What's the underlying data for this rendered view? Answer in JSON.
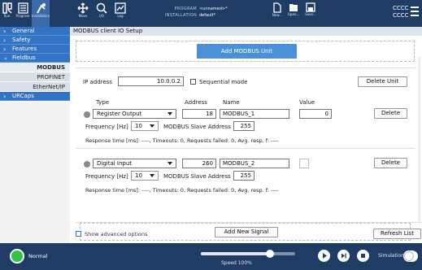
{
  "header": {
    "run": "Run",
    "program": "Program",
    "installation": "Installation",
    "move": "Move",
    "io": "I/O",
    "log": "Log",
    "program_label": "PROGRAM",
    "program_value": "<unnamed>*",
    "installation_label": "INSTALLATION",
    "installation_value": "default*",
    "new": "New...",
    "open": "Open...",
    "save": "Save...",
    "cccc1": "CCCC",
    "cccc2": "CCCC"
  },
  "sidebar": {
    "items": [
      {
        "label": "General"
      },
      {
        "label": "Safety"
      },
      {
        "label": "Features"
      },
      {
        "label": "Fieldbus"
      },
      {
        "label": "URCaps"
      }
    ],
    "sub": [
      {
        "label": "MODBUS"
      },
      {
        "label": "PROFINET"
      },
      {
        "label": "EtherNet/IP"
      }
    ]
  },
  "main": {
    "title": "MODBUS client IO Setup",
    "add_unit": "Add MODBUS Unit",
    "ip_label": "IP address",
    "ip_value": "10.0.0.2",
    "sequential": "Sequential mode",
    "delete_unit": "Delete Unit",
    "col_type": "Type",
    "col_address": "Address",
    "col_name": "Name",
    "col_value": "Value",
    "signals": [
      {
        "type": "Register Output",
        "address": "18",
        "name": "MODBUS_1",
        "value": "0",
        "delete": "Delete",
        "freq_label": "Frequency [Hz]",
        "freq": "10",
        "slave_label": "MODBUS Slave Address",
        "slave": "255",
        "response": "Response time [ms]: ----,   Timeouts:   0,   Requests failed:   0,   Avg. resp. f: ----"
      },
      {
        "type": "Digital Input",
        "address": "260",
        "name": "MODBUS_2",
        "value": "",
        "delete": "Delete",
        "freq_label": "Frequency [Hz]",
        "freq": "10",
        "slave_label": "MODBUS Slave Address",
        "slave": "255",
        "response": "Response time [ms]: ----,   Timeouts:   0,   Requests failed:   0,   Avg. resp. f: ----"
      }
    ],
    "add_signal": "Add New Signal",
    "show_advanced": "Show advanced options",
    "refresh": "Refresh List"
  },
  "footer": {
    "status": "Normal",
    "speed": "Speed 100%",
    "speed_fraction": 0.73,
    "simulation": "Simulation"
  },
  "colors": {
    "header": "#1e3c64",
    "accent": "#3273c6",
    "button": "#4a90d9",
    "status": "#2cc640"
  }
}
